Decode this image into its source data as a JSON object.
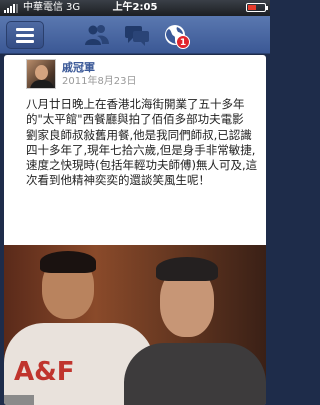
{
  "status_bar": {
    "carrier": "中華電信",
    "network": "3G",
    "time": "上午2:05"
  },
  "nav": {
    "notification_count": "1"
  },
  "post": {
    "author": "戚冠軍",
    "date": "2011年8月23日",
    "text": "八月廿日晚上在香港北海街開業了五十多年的\"太平館\"西餐廳與拍了佰佰多部功夫電影 劉家良師叔敍舊用餐,他是我同們師叔,已認識四十多年了,現年七拾六歲,但是身手非常敏捷,速度之快現時(包括年輕功夫師傅)無人可及,這次看到他精神奕奕的還談笑風生呢！",
    "photo": {
      "shirt_text": "A&F"
    }
  }
}
